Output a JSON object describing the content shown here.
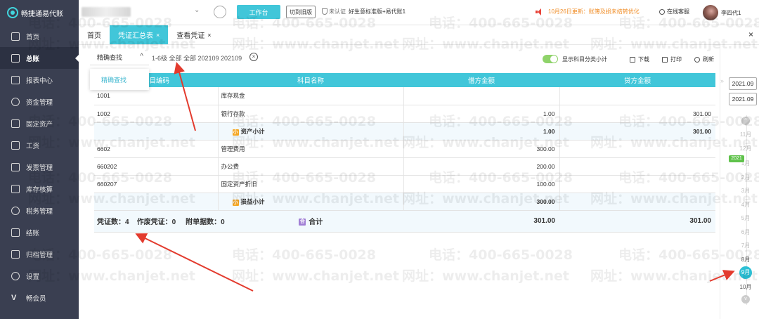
{
  "app": {
    "logo_text": "畅捷通易代账",
    "workbench_label": "工作台",
    "old_version_label": "切到旧版",
    "auth_status": "未认证",
    "plan": "好生意标准版+易代账1",
    "notice": "10月26日更新：账簿及损未结转优化",
    "support_label": "在线客服",
    "user_name": "李四代1"
  },
  "sidebar": {
    "items": [
      {
        "label": "首页"
      },
      {
        "label": "总账"
      },
      {
        "label": "报表中心"
      },
      {
        "label": "资金管理"
      },
      {
        "label": "固定资产"
      },
      {
        "label": "工资"
      },
      {
        "label": "发票管理"
      },
      {
        "label": "库存核算"
      },
      {
        "label": "税务管理"
      },
      {
        "label": "结账"
      },
      {
        "label": "归档管理"
      },
      {
        "label": "设置"
      },
      {
        "label": "畅会员"
      }
    ]
  },
  "tabs": [
    {
      "label": "首页",
      "closable": false
    },
    {
      "label": "凭证汇总表",
      "closable": true,
      "active": true
    },
    {
      "label": "查看凭证",
      "closable": true
    }
  ],
  "filter": {
    "precise_label": "精确查找",
    "summary": "1-6级   全部  全部  202109  202109",
    "dropdown_item": "精确查找",
    "toggle_label": "显示科目分类小计",
    "download_label": "下载",
    "print_label": "打印",
    "refresh_label": "刷新"
  },
  "table": {
    "headers": [
      "科目编码",
      "科目名称",
      "借方金额",
      "贷方金额"
    ],
    "rows": [
      {
        "code": "1001",
        "name": "库存现金",
        "debit": "",
        "credit": ""
      },
      {
        "code": "1002",
        "name": "银行存款",
        "debit": "1.00",
        "credit": "301.00"
      },
      {
        "subtotal": "资产小计",
        "debit": "1.00",
        "credit": "301.00"
      },
      {
        "code": "6602",
        "name": "管理费用",
        "debit": "300.00",
        "credit": ""
      },
      {
        "code": "660202",
        "name": "办公费",
        "debit": "200.00",
        "credit": ""
      },
      {
        "code": "660207",
        "name": "固定资产折旧",
        "debit": "100.00",
        "credit": ""
      },
      {
        "subtotal": "损益小计",
        "debit": "300.00",
        "credit": ""
      }
    ],
    "sub_icon": "小",
    "sum_icon": "合",
    "total": {
      "voucher_count": "凭证数：4",
      "void_count": "作废凭证：0",
      "attach_count": "附单据数：0",
      "label": "合计",
      "debit": "301.00",
      "credit": "301.00"
    }
  },
  "period": {
    "start": "2021.09",
    "end": "2021.09",
    "year_tag": "2021",
    "months_prev_year": [
      "11月",
      "12月"
    ],
    "months": [
      "1月",
      "2月",
      "3月",
      "4月",
      "5月",
      "6月",
      "7月",
      "8月",
      "9月",
      "10月"
    ],
    "selected": "9月"
  },
  "watermark": {
    "phone": "电话：400-665-0028",
    "site": "网址：www.chanjet.net"
  },
  "colors": {
    "accent": "#41c6d9",
    "sidebar": "#3a3f51",
    "toggle_on": "#8fd36a",
    "notice": "#f08c25",
    "annotation": "#e33b2e"
  }
}
